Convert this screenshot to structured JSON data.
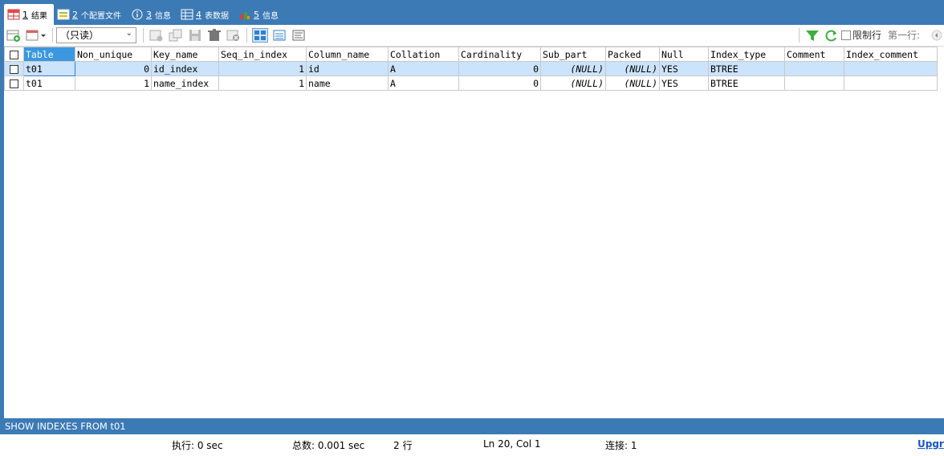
{
  "tabs": [
    {
      "num": "1",
      "label": "结果",
      "icon": "table-result-icon"
    },
    {
      "num": "2",
      "label": "个配置文件",
      "icon": "profile-icon"
    },
    {
      "num": "3",
      "label": "信息",
      "icon": "info-icon"
    },
    {
      "num": "4",
      "label": "表数据",
      "icon": "table-data-icon"
    },
    {
      "num": "5",
      "label": "信息",
      "icon": "info-chart-icon"
    }
  ],
  "toolbar": {
    "mode_select": "（只读）",
    "limit_label": "限制行",
    "first_row_label": "第一行:"
  },
  "grid": {
    "columns": [
      "Table",
      "Non_unique",
      "Key_name",
      "Seq_in_index",
      "Column_name",
      "Collation",
      "Cardinality",
      "Sub_part",
      "Packed",
      "Null",
      "Index_type",
      "Comment",
      "Index_comment"
    ],
    "rows": [
      [
        "t01",
        "0",
        "id_index",
        "1",
        "id",
        "A",
        "0",
        "(NULL)",
        "(NULL)",
        "YES",
        "BTREE",
        "",
        ""
      ],
      [
        "t01",
        "1",
        "name_index",
        "1",
        "name",
        "A",
        "0",
        "(NULL)",
        "(NULL)",
        "YES",
        "BTREE",
        "",
        ""
      ]
    ]
  },
  "sql": "SHOW INDEXES FROM t01",
  "status": {
    "exec": "执行: 0 sec",
    "total": "总数: 0.001 sec",
    "rows": "2 行",
    "position": "Ln 20, Col 1",
    "connection": "连接: 1",
    "upgrade": "Upgr"
  },
  "colors": {
    "frame": "#3c7ab6",
    "selected_header": "#3a97e0",
    "selected_row": "#cbe3fb"
  }
}
